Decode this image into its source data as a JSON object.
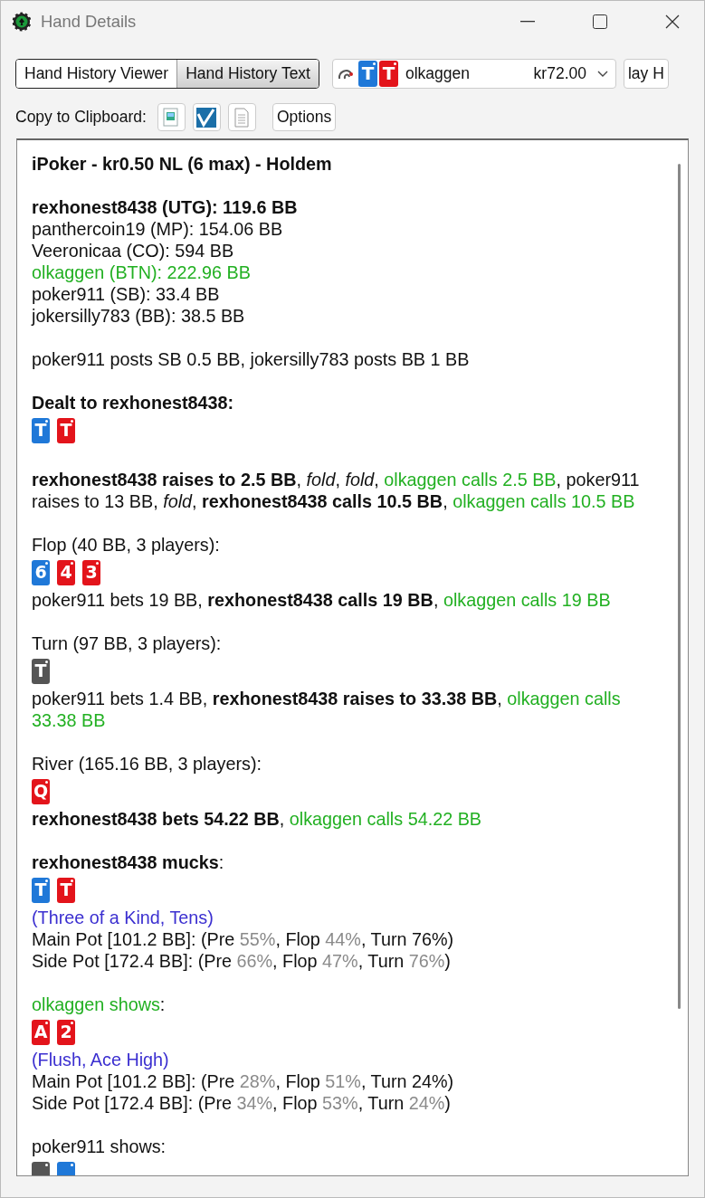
{
  "window": {
    "title": "Hand Details"
  },
  "view_tabs": [
    {
      "label": "Hand History Viewer",
      "selected": false
    },
    {
      "label": "Hand History Text",
      "selected": true
    }
  ],
  "hand_select": {
    "cards": [
      {
        "rank": "T",
        "color": "#1f78d8"
      },
      {
        "rank": "T",
        "color": "#e3141b"
      }
    ],
    "player": "olkaggen",
    "amount": "kr72.00"
  },
  "replay_button": {
    "label": "lay H"
  },
  "clipboard": {
    "label": "Copy to Clipboard:",
    "options_label": "Options"
  },
  "history": [
    {
      "kind": "line",
      "segments": [
        {
          "text": "**iPoker - kr0.50 NL (6 max) - Holdem**",
          "color": "#111111"
        }
      ]
    },
    {
      "kind": "gap"
    },
    {
      "kind": "line",
      "segments": [
        {
          "text": "**rexhonest8438 (UTG): 119.6 BB**",
          "color": "#111111"
        }
      ]
    },
    {
      "kind": "line",
      "segments": [
        {
          "text": "panthercoin19 (MP): 154.06 BB",
          "color": "#111111"
        }
      ]
    },
    {
      "kind": "line",
      "segments": [
        {
          "text": "Veeronicaa (CO): 594 BB",
          "color": "#111111"
        }
      ]
    },
    {
      "kind": "line",
      "segments": [
        {
          "text": "olkaggen (BTN): 222.96 BB",
          "color": "#22b022"
        }
      ]
    },
    {
      "kind": "line",
      "segments": [
        {
          "text": "poker911 (SB): 33.4 BB",
          "color": "#111111"
        }
      ]
    },
    {
      "kind": "line",
      "segments": [
        {
          "text": "jokersilly783 (BB): 38.5 BB",
          "color": "#111111"
        }
      ]
    },
    {
      "kind": "gap"
    },
    {
      "kind": "line",
      "segments": [
        {
          "text": "poker911 posts SB 0.5 BB, jokersilly783 posts BB 1 BB",
          "color": "#111111"
        }
      ]
    },
    {
      "kind": "gap"
    },
    {
      "kind": "line",
      "segments": [
        {
          "text": "**Dealt to rexhonest8438:**",
          "color": "#111111"
        }
      ]
    },
    {
      "kind": "cards",
      "cards": [
        {
          "rank": "T",
          "color": "#1f78d8"
        },
        {
          "rank": "T",
          "color": "#e3141b"
        }
      ]
    },
    {
      "kind": "gap"
    },
    {
      "kind": "line",
      "segments": [
        {
          "text": "**rexhonest8438 raises to 2.5 BB**, *fold*, *fold*, ",
          "color": "#111111"
        },
        {
          "text": "olkaggen calls 2.5 BB",
          "color": "#22b022"
        },
        {
          "text": ", poker911 raises to 13 BB, *fold*, **rexhonest8438 calls 10.5 BB**, ",
          "color": "#111111"
        },
        {
          "text": "olkaggen calls 10.5 BB",
          "color": "#22b022"
        }
      ]
    },
    {
      "kind": "gap"
    },
    {
      "kind": "line",
      "segments": [
        {
          "text": "Flop (40 BB, 3 players):",
          "color": "#111111"
        }
      ]
    },
    {
      "kind": "cards",
      "cards": [
        {
          "rank": "6",
          "color": "#1f78d8"
        },
        {
          "rank": "4",
          "color": "#e3141b"
        },
        {
          "rank": "3",
          "color": "#e3141b"
        }
      ]
    },
    {
      "kind": "line",
      "segments": [
        {
          "text": "poker911 bets 19 BB, **rexhonest8438 calls 19 BB**, ",
          "color": "#111111"
        },
        {
          "text": "olkaggen calls 19 BB",
          "color": "#22b022"
        }
      ]
    },
    {
      "kind": "gap"
    },
    {
      "kind": "line",
      "segments": [
        {
          "text": "Turn (97 BB, 3 players):",
          "color": "#111111"
        }
      ]
    },
    {
      "kind": "cards",
      "cards": [
        {
          "rank": "T",
          "color": "#555555"
        }
      ]
    },
    {
      "kind": "line",
      "segments": [
        {
          "text": "poker911 bets 1.4 BB, **rexhonest8438 raises to 33.38 BB**, ",
          "color": "#111111"
        },
        {
          "text": "olkaggen calls 33.38 BB",
          "color": "#22b022"
        }
      ]
    },
    {
      "kind": "gap"
    },
    {
      "kind": "line",
      "segments": [
        {
          "text": "River (165.16 BB, 3 players):",
          "color": "#111111"
        }
      ]
    },
    {
      "kind": "cards",
      "cards": [
        {
          "rank": "Q",
          "color": "#e3141b"
        }
      ]
    },
    {
      "kind": "line",
      "segments": [
        {
          "text": "**rexhonest8438 bets 54.22 BB**, ",
          "color": "#111111"
        },
        {
          "text": "olkaggen calls 54.22 BB",
          "color": "#22b022"
        }
      ]
    },
    {
      "kind": "gap"
    },
    {
      "kind": "line",
      "segments": [
        {
          "text": "**rexhonest8438 mucks**:",
          "color": "#111111"
        }
      ]
    },
    {
      "kind": "cards",
      "cards": [
        {
          "rank": "T",
          "color": "#1f78d8"
        },
        {
          "rank": "T",
          "color": "#e3141b"
        }
      ]
    },
    {
      "kind": "line",
      "segments": [
        {
          "text": "(Three of a Kind, Tens)",
          "color": "#3b2fd0"
        }
      ]
    },
    {
      "kind": "line",
      "segments": [
        {
          "text": "Main Pot [101.2 BB]: (Pre ",
          "color": "#111111"
        },
        {
          "text": "55%",
          "color": "#8a8a8a"
        },
        {
          "text": ", Flop ",
          "color": "#111111"
        },
        {
          "text": "44%",
          "color": "#8a8a8a"
        },
        {
          "text": ", Turn 76%)",
          "color": "#111111"
        }
      ]
    },
    {
      "kind": "line",
      "segments": [
        {
          "text": "Side Pot [172.4 BB]: (Pre ",
          "color": "#111111"
        },
        {
          "text": "66%",
          "color": "#8a8a8a"
        },
        {
          "text": ", Flop ",
          "color": "#111111"
        },
        {
          "text": "47%",
          "color": "#8a8a8a"
        },
        {
          "text": ", Turn ",
          "color": "#111111"
        },
        {
          "text": "76%",
          "color": "#8a8a8a"
        },
        {
          "text": ")",
          "color": "#111111"
        }
      ]
    },
    {
      "kind": "gap"
    },
    {
      "kind": "line",
      "segments": [
        {
          "text": "olkaggen shows",
          "color": "#22b022"
        },
        {
          "text": ":",
          "color": "#111111"
        }
      ]
    },
    {
      "kind": "cards",
      "cards": [
        {
          "rank": "A",
          "color": "#e3141b"
        },
        {
          "rank": "2",
          "color": "#e3141b"
        }
      ]
    },
    {
      "kind": "line",
      "segments": [
        {
          "text": "(Flush, Ace High)",
          "color": "#3b2fd0"
        }
      ]
    },
    {
      "kind": "line",
      "segments": [
        {
          "text": "Main Pot [101.2 BB]: (Pre ",
          "color": "#111111"
        },
        {
          "text": "28%",
          "color": "#8a8a8a"
        },
        {
          "text": ", Flop ",
          "color": "#111111"
        },
        {
          "text": "51%",
          "color": "#8a8a8a"
        },
        {
          "text": ", Turn 24%)",
          "color": "#111111"
        }
      ]
    },
    {
      "kind": "line",
      "segments": [
        {
          "text": "Side Pot [172.4 BB]: (Pre ",
          "color": "#111111"
        },
        {
          "text": "34%",
          "color": "#8a8a8a"
        },
        {
          "text": ", Flop ",
          "color": "#111111"
        },
        {
          "text": "53%",
          "color": "#8a8a8a"
        },
        {
          "text": ", Turn ",
          "color": "#111111"
        },
        {
          "text": "24%",
          "color": "#8a8a8a"
        },
        {
          "text": ")",
          "color": "#111111"
        }
      ]
    },
    {
      "kind": "gap"
    },
    {
      "kind": "line",
      "segments": [
        {
          "text": "poker911 shows:",
          "color": "#111111"
        }
      ]
    },
    {
      "kind": "cards",
      "cards": [
        {
          "color": "#555555"
        },
        {
          "color": "#1f78d8"
        }
      ]
    }
  ]
}
